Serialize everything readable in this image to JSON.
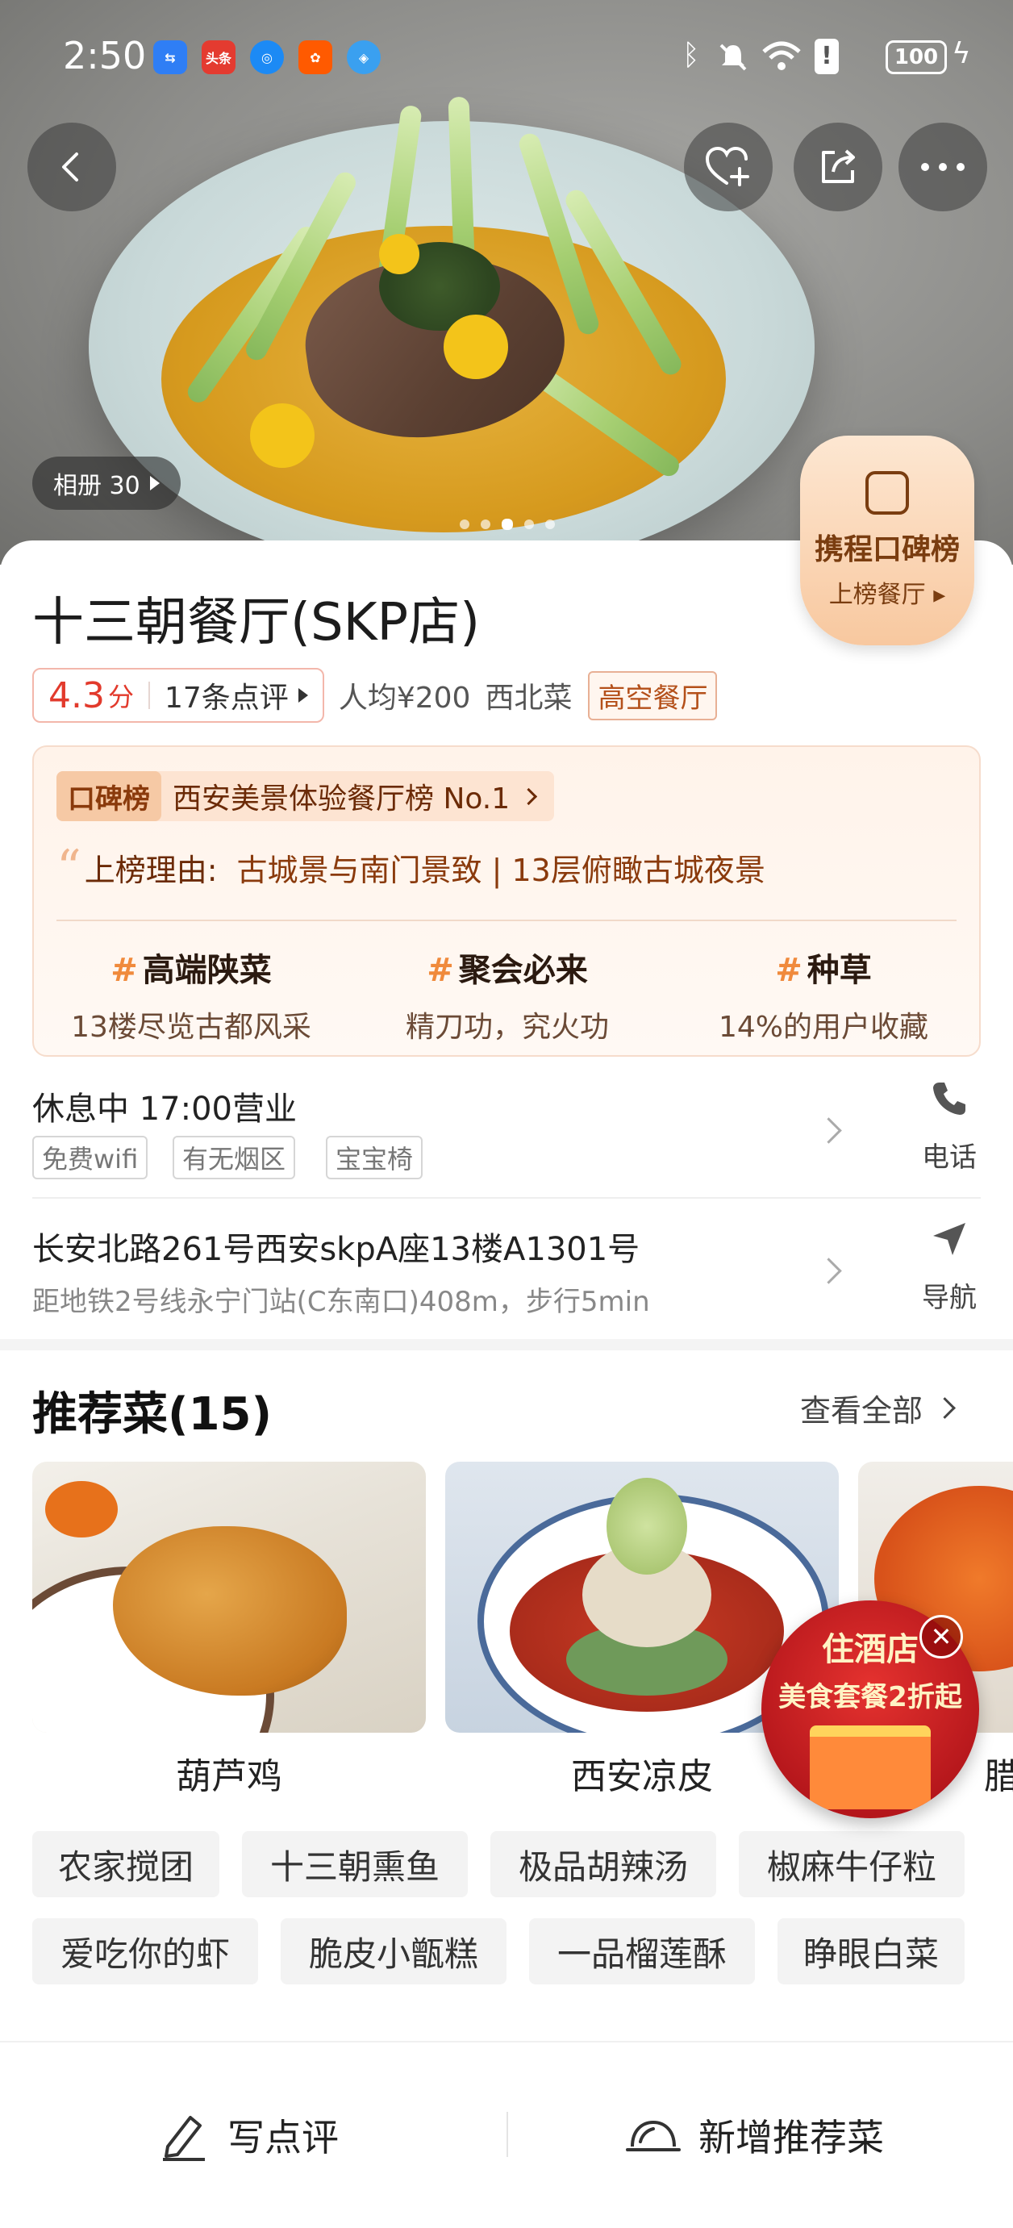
{
  "status_bar": {
    "time": "2:50",
    "apps": [
      {
        "icon": "usb-icon",
        "label": "",
        "color": "#2f7ef5"
      },
      {
        "icon": "toutiao-icon",
        "label": "头条",
        "color": "#e43b30"
      },
      {
        "icon": "browser-icon",
        "label": "",
        "color": "#1c8af5"
      },
      {
        "icon": "taobao-icon",
        "label": "",
        "color": "#ff5a00"
      },
      {
        "icon": "compass-icon",
        "label": "",
        "color": "#3aa0f0"
      }
    ],
    "battery": "100"
  },
  "hero": {
    "album_label": "相册 30",
    "page_count": 5,
    "active_page": 3
  },
  "ctrip_badge": {
    "title": "携程口碑榜",
    "action": "上榜餐厅"
  },
  "restaurant": {
    "name": "十三朝餐厅(SKP店)",
    "score": "4.3",
    "score_unit": "分",
    "reviews": "17条点评",
    "avg_price": "人均¥200",
    "cuisine": "西北菜",
    "tag": "高空餐厅"
  },
  "ranking": {
    "logo": "口碑榜",
    "title": "西安美景体验餐厅榜 No.1",
    "reason_label": "上榜理由:",
    "reason_text": "古城景与南门景致 | 13层俯瞰古城夜景",
    "highlights": [
      {
        "title": "高端陕菜",
        "desc": "13楼尽览古都风采"
      },
      {
        "title": "聚会必来",
        "desc": "精刀功，究火功"
      },
      {
        "title": "种草",
        "desc": "14%的用户收藏"
      }
    ]
  },
  "hours": {
    "status": "休息中 17:00营业",
    "features": [
      "免费wifi",
      "有无烟区",
      "宝宝椅"
    ],
    "phone_label": "电话"
  },
  "address": {
    "line1": "长安北路261号西安skpA座13楼A1301号",
    "line2": "距地铁2号线永宁门站(C东南口)408m，步行5min",
    "nav_label": "导航"
  },
  "recommended": {
    "title": "推荐菜(15)",
    "see_all": "查看全部",
    "dishes": [
      {
        "name": "葫芦鸡"
      },
      {
        "name": "西安凉皮"
      },
      {
        "name": "腊"
      }
    ],
    "chips_row1": [
      "农家搅团",
      "十三朝熏鱼",
      "极品胡辣汤",
      "椒麻牛仔粒"
    ],
    "chips_row2": [
      "爱吃你的虾",
      "脆皮小甑糕",
      "一品榴莲酥",
      "睁眼白菜"
    ]
  },
  "float_ad": {
    "line1": "住酒店",
    "line2": "美食套餐2折起"
  },
  "bottom_bar": {
    "write_review": "写点评",
    "add_dish": "新增推荐菜"
  },
  "colors": {
    "accent_red": "#e23a2c",
    "rank_brown": "#6b2a06",
    "rank_bg": "#fff3ea"
  }
}
